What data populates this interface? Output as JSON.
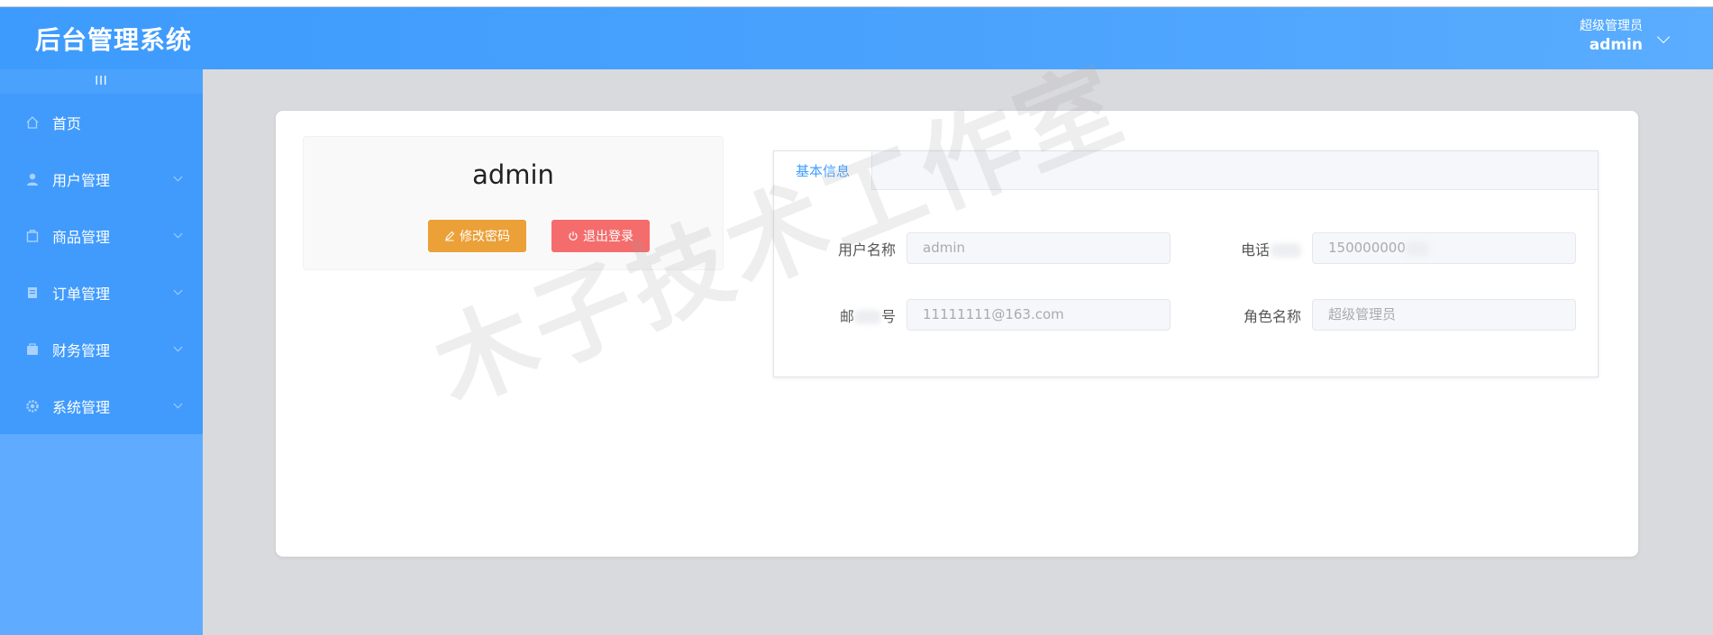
{
  "header": {
    "title": "后台管理系统",
    "role": "超级管理员",
    "username": "admin"
  },
  "sidebar": {
    "collapse_label": "III",
    "items": [
      {
        "label": "首页",
        "icon": "home-icon",
        "has_arrow": false
      },
      {
        "label": "用户管理",
        "icon": "user-icon",
        "has_arrow": true
      },
      {
        "label": "商品管理",
        "icon": "product-icon",
        "has_arrow": true
      },
      {
        "label": "订单管理",
        "icon": "order-icon",
        "has_arrow": true
      },
      {
        "label": "财务管理",
        "icon": "finance-icon",
        "has_arrow": true
      },
      {
        "label": "系统管理",
        "icon": "settings-icon",
        "has_arrow": true
      }
    ]
  },
  "profile": {
    "username": "admin",
    "change_password_label": "修改密码",
    "logout_label": "退出登录"
  },
  "info_tab": {
    "tab_label": "基本信息",
    "fields": {
      "username": {
        "label": "用户名称",
        "value": "admin"
      },
      "phone": {
        "label_visible": "电话",
        "value_visible": "150000000"
      },
      "email": {
        "label_start": "邮",
        "label_end": "号",
        "value": "11111111@163.com"
      },
      "role": {
        "label": "角色名称",
        "value": "超级管理员"
      }
    }
  },
  "watermark": "木子技术工作室",
  "colors": {
    "header": "#4aa2fd",
    "sidebar": "#419bfd",
    "primary": "#409eff",
    "warning": "#eba038",
    "danger": "#f56c6c"
  }
}
